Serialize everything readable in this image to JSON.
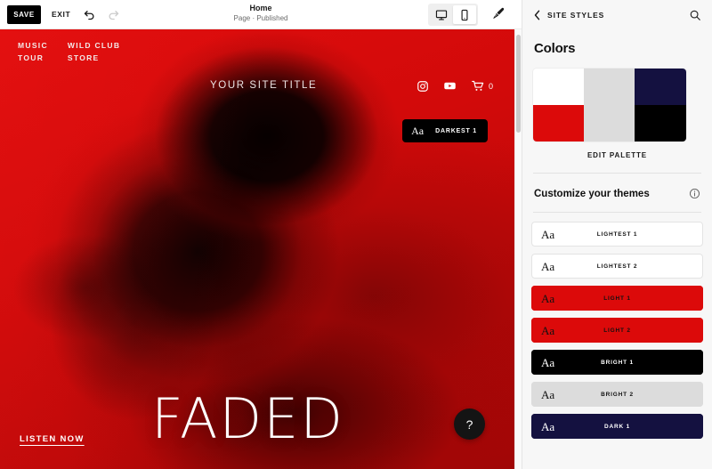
{
  "toolbar": {
    "save_label": "SAVE",
    "exit_label": "EXIT",
    "undo_icon": "undo-arrow-icon",
    "redo_icon": "redo-arrow-icon",
    "page_title": "Home",
    "page_status": "Page · Published",
    "desktop_icon": "desktop-monitor-icon",
    "mobile_icon": "mobile-phone-icon",
    "mobile_active": true,
    "brush_icon": "paintbrush-icon"
  },
  "preview": {
    "nav_links": [
      "MUSIC",
      "WILD CLUB",
      "TOUR",
      "STORE"
    ],
    "site_title": "YOUR SITE TITLE",
    "social": [
      {
        "name": "instagram-icon"
      },
      {
        "name": "youtube-icon"
      }
    ],
    "cart_icon": "shopping-cart-icon",
    "cart_count": "0",
    "theme_badge": {
      "sample": "Aa",
      "label": "DARKEST 1"
    },
    "hero_title": "FADED",
    "cta_label": "LISTEN NOW",
    "help_label": "?"
  },
  "sidebar": {
    "back_icon": "chevron-left-icon",
    "header_title": "SITE STYLES",
    "search_icon": "search-icon",
    "colors_title": "Colors",
    "palette": {
      "swatches": [
        {
          "name": "white",
          "hex": "#FFFFFF"
        },
        {
          "name": "red",
          "hex": "#DC0A0A"
        },
        {
          "name": "light-gray",
          "hex": "#DCDCDC"
        },
        {
          "name": "navy",
          "hex": "#141140"
        },
        {
          "name": "black",
          "hex": "#000000"
        }
      ]
    },
    "edit_palette_label": "EDIT PALETTE",
    "themes_title": "Customize your themes",
    "info_icon": "info-circle-icon",
    "themes": [
      {
        "sample": "Aa",
        "label": "LIGHTEST 1",
        "bg": "#FFFFFF",
        "fg": "#111111",
        "border": "#E3E3E3"
      },
      {
        "sample": "Aa",
        "label": "LIGHTEST 2",
        "bg": "#FFFFFF",
        "fg": "#111111",
        "border": "#E3E3E3"
      },
      {
        "sample": "Aa",
        "label": "LIGHT 1",
        "bg": "#DC0A0A",
        "fg": "#111111",
        "border": "#DC0A0A"
      },
      {
        "sample": "Aa",
        "label": "LIGHT 2",
        "bg": "#DC0A0A",
        "fg": "#111111",
        "border": "#DC0A0A"
      },
      {
        "sample": "Aa",
        "label": "BRIGHT 1",
        "bg": "#000000",
        "fg": "#FFFFFF",
        "border": "#000000"
      },
      {
        "sample": "Aa",
        "label": "BRIGHT 2",
        "bg": "#DCDCDC",
        "fg": "#111111",
        "border": "#DCDCDC"
      },
      {
        "sample": "Aa",
        "label": "DARK 1",
        "bg": "#141140",
        "fg": "#FFFFFF",
        "border": "#141140"
      }
    ]
  }
}
